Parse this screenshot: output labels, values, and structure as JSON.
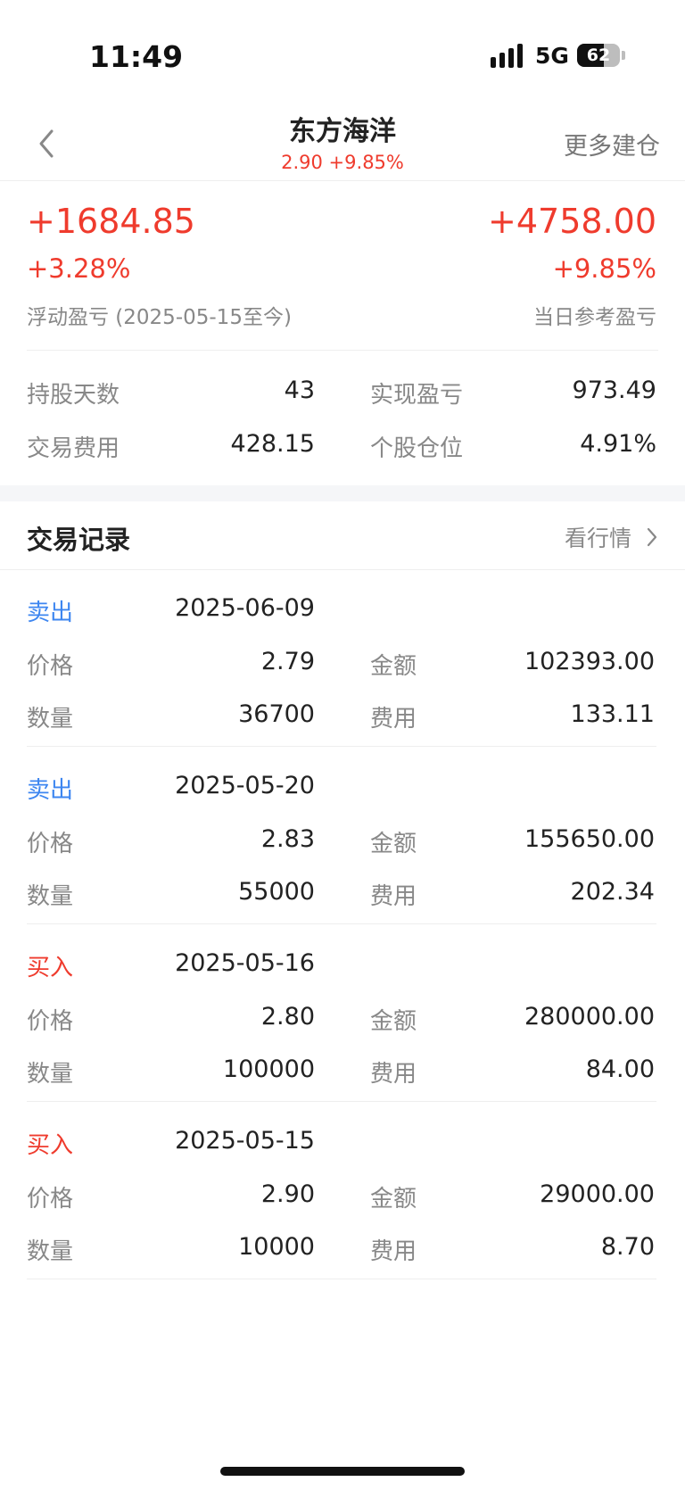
{
  "status": {
    "time": "11:49",
    "network": "5G",
    "battery": "62",
    "battery_level": 0.62
  },
  "header": {
    "title": "东方海洋",
    "subtitle": "2.90 +9.85%",
    "more_label": "更多建仓"
  },
  "summary": {
    "float_pl": "+1684.85",
    "float_pct": "+3.28%",
    "float_caption": "浮动盈亏 (2025-05-15至今)",
    "day_pl": "+4758.00",
    "day_pct": "+9.85%",
    "day_caption": "当日参考盈亏"
  },
  "stats": {
    "hold_days_label": "持股天数",
    "hold_days": "43",
    "realized_label": "实现盈亏",
    "realized": "973.49",
    "fee_label": "交易费用",
    "fee": "428.15",
    "position_label": "个股仓位",
    "position": "4.91%"
  },
  "records_section": {
    "title": "交易记录",
    "link": "看行情"
  },
  "labels": {
    "price": "价格",
    "amount": "金额",
    "quantity": "数量",
    "fee": "费用"
  },
  "records": [
    {
      "type": "卖出",
      "date": "2025-06-09",
      "price": "2.79",
      "amount": "102393.00",
      "quantity": "36700",
      "fee": "133.11"
    },
    {
      "type": "卖出",
      "date": "2025-05-20",
      "price": "2.83",
      "amount": "155650.00",
      "quantity": "55000",
      "fee": "202.34"
    },
    {
      "type": "买入",
      "date": "2025-05-16",
      "price": "2.80",
      "amount": "280000.00",
      "quantity": "100000",
      "fee": "84.00"
    },
    {
      "type": "买入",
      "date": "2025-05-15",
      "price": "2.90",
      "amount": "29000.00",
      "quantity": "10000",
      "fee": "8.70"
    }
  ],
  "colors": {
    "up": "#ef3b2d",
    "sell": "#3d86f0",
    "buy": "#ef3b2d"
  }
}
